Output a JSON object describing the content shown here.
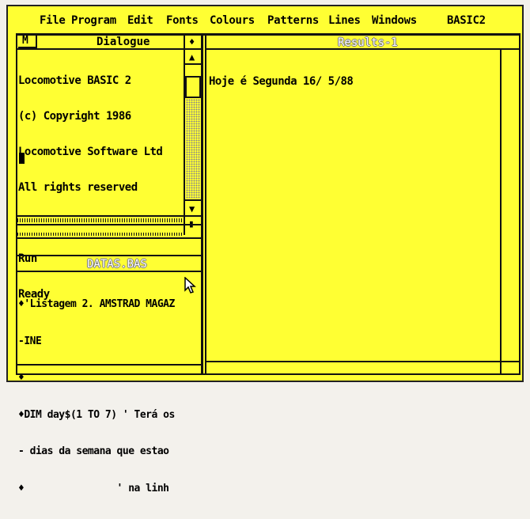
{
  "menu": {
    "items": [
      "File",
      "Program",
      "Edit",
      "Fonts",
      "Colours",
      "Patterns",
      "Lines",
      "Windows"
    ],
    "app_name": "BASIC2"
  },
  "dialogue_window": {
    "close_box": "M",
    "title": "Dialogue",
    "lines": [
      "Locomotive BASIC 2",
      "(c) Copyright 1986",
      "Locomotive Software Ltd",
      "All rights reserved",
      "",
      "Run",
      "Ready"
    ]
  },
  "results_window": {
    "title": "Results-1",
    "lines": [
      "Hoje é Segunda 16/ 5/88"
    ]
  },
  "program_window": {
    "title": "DATAS.BAS",
    "lines": [
      "♦'Listagem 2. AMSTRAD MAGAZ",
      "-INE",
      "♦",
      "♦DIM day$(1 TO 7) ' Terá os",
      "- dias da semana que estao",
      "♦                ' na linh"
    ]
  },
  "icons": {
    "scroll_up": "up-arrow-icon",
    "scroll_down": "down-arrow-icon",
    "resize": "diamond-icon",
    "cursor": "mouse-pointer-icon"
  },
  "colors": {
    "screen": "#ffff33",
    "ink": "#000000"
  }
}
